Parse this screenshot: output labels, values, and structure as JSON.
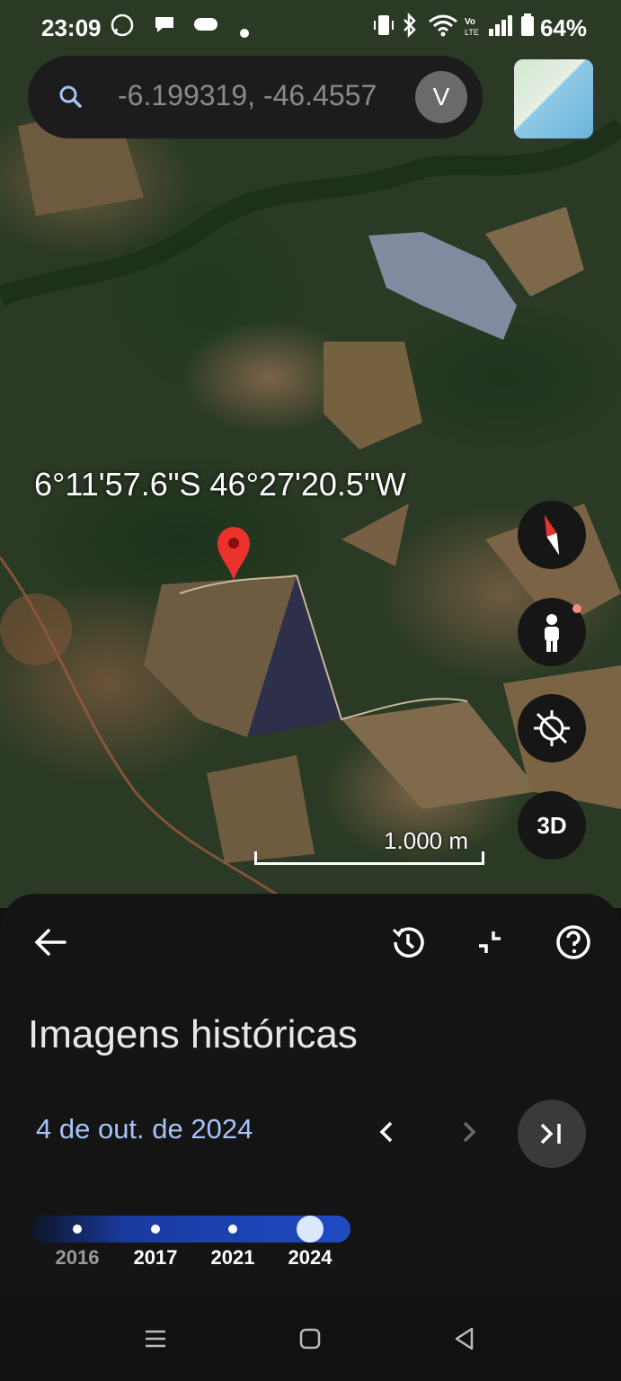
{
  "status_bar": {
    "time": "23:09",
    "battery_percent": "64%"
  },
  "search": {
    "query": "-6.199319, -46.4557",
    "avatar_initial": "V"
  },
  "map": {
    "coordinates_label": "6°11'57.6\"S 46°27'20.5\"W",
    "scale_label": "1.000 m",
    "mode_3d_label": "3D"
  },
  "historical_panel": {
    "title": "Imagens históricas",
    "selected_date": "4 de out. de 2024",
    "timeline": {
      "years": [
        "2016",
        "2017",
        "2021",
        "2024"
      ],
      "selected_year": "2024"
    }
  },
  "icons": {
    "back": "arrow-left-icon",
    "history": "history-icon",
    "collapse": "collapse-icon",
    "help": "help-icon",
    "compass": "compass-icon",
    "pegman": "street-view-icon",
    "location": "location-off-icon"
  }
}
